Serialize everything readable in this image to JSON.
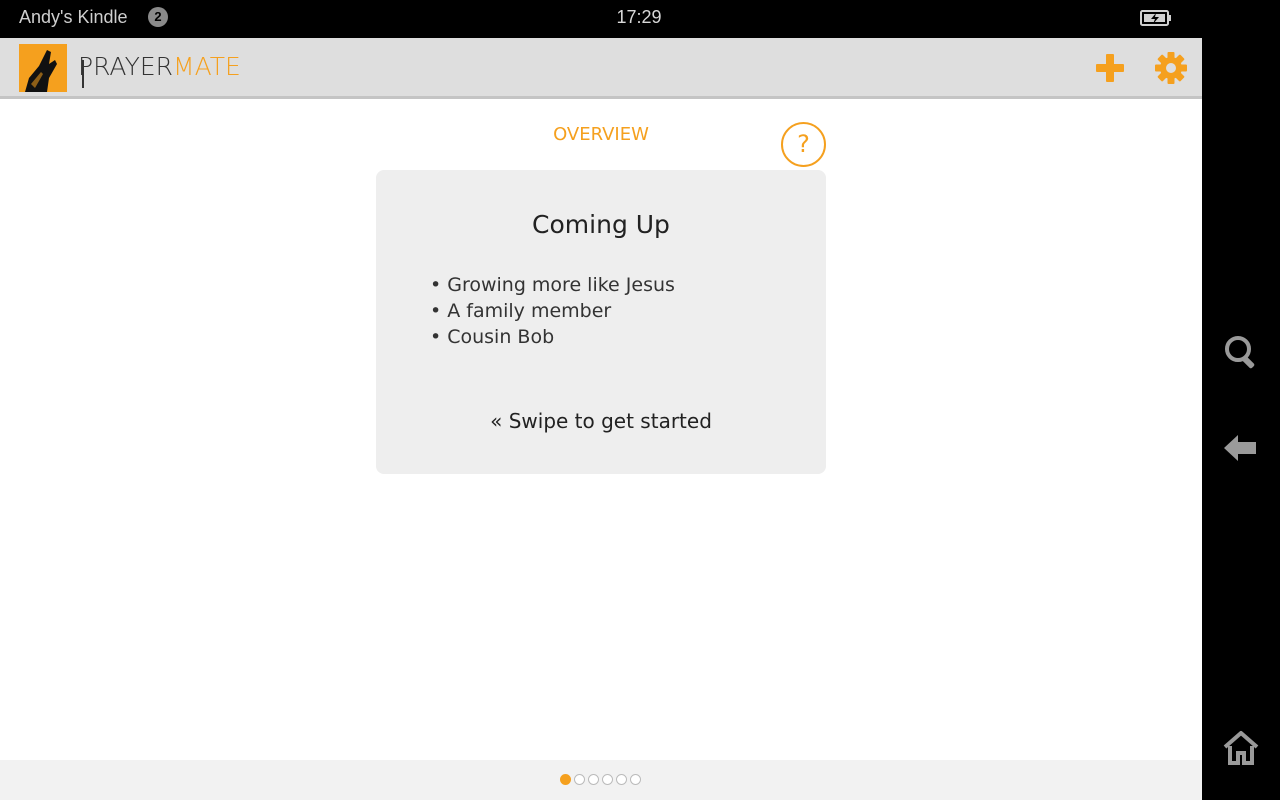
{
  "status_bar": {
    "device_name": "Andy's Kindle",
    "notification_count": "2",
    "time": "17:29"
  },
  "app_bar": {
    "logo_prayer": "PRAYER",
    "logo_mate": "MATE"
  },
  "content": {
    "section_title": "OVERVIEW",
    "help_label": "?",
    "card": {
      "title": "Coming Up",
      "items": [
        "Growing more like Jesus",
        "A family member",
        "Cousin Bob"
      ],
      "hint": "« Swipe to get started"
    }
  },
  "pager": {
    "total": 6,
    "current": 1
  },
  "colors": {
    "accent": "#f5a01e"
  },
  "icons": {
    "add": "plus-icon",
    "settings": "gear-icon",
    "search": "search-icon",
    "back": "back-arrow-icon",
    "home": "home-icon",
    "battery": "battery-charging-icon"
  }
}
